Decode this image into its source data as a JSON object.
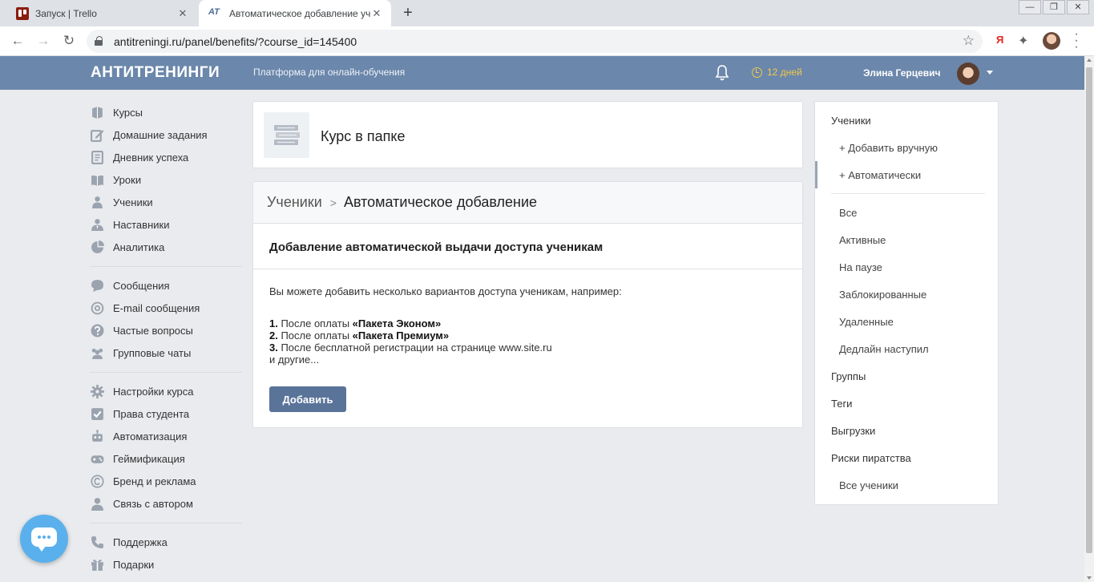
{
  "browser": {
    "tabs": [
      {
        "title": "Запуск | Trello",
        "close": "✕"
      },
      {
        "title": "Автоматическое добавление уч",
        "close": "✕",
        "favicon_text": "AT"
      }
    ],
    "new_tab": "+",
    "url": "antitreningi.ru/panel/benefits/?course_id=145400",
    "window_buttons": [
      "—",
      "❐",
      "✕"
    ],
    "ext_ya": "Я"
  },
  "header": {
    "logo": "АНТИТРЕНИНГИ",
    "tagline": "Платформа для онлайн-обучения",
    "trial": "12 дней",
    "username": "Элина Герцевич",
    "accent_color": "#6b87ab",
    "trial_color": "#f3c84a"
  },
  "nav": {
    "group1": [
      {
        "label": "Курсы",
        "icon": "book-icon"
      },
      {
        "label": "Домашние задания",
        "icon": "edit-icon"
      },
      {
        "label": "Дневник успеха",
        "icon": "diary-icon"
      },
      {
        "label": "Уроки",
        "icon": "lessons-icon"
      },
      {
        "label": "Ученики",
        "icon": "students-icon"
      },
      {
        "label": "Наставники",
        "icon": "mentors-icon"
      },
      {
        "label": "Аналитика",
        "icon": "pie-chart-icon"
      }
    ],
    "group2": [
      {
        "label": "Сообщения",
        "icon": "messages-icon"
      },
      {
        "label": "E-mail сообщения",
        "icon": "at-icon"
      },
      {
        "label": "Частые вопросы",
        "icon": "question-icon"
      },
      {
        "label": "Групповые чаты",
        "icon": "group-chat-icon"
      }
    ],
    "group3": [
      {
        "label": "Настройки курса",
        "icon": "gear-icon"
      },
      {
        "label": "Права студента",
        "icon": "checkbox-icon"
      },
      {
        "label": "Автоматизация",
        "icon": "robot-icon"
      },
      {
        "label": "Геймификация",
        "icon": "gamepad-icon"
      },
      {
        "label": "Бренд и реклама",
        "icon": "copyright-icon"
      },
      {
        "label": "Связь с автором",
        "icon": "user-icon"
      }
    ],
    "group4": [
      {
        "label": "Поддержка",
        "icon": "phone-icon"
      },
      {
        "label": "Подарки",
        "icon": "gift-icon"
      }
    ]
  },
  "course": {
    "title": "Курс в папке"
  },
  "main": {
    "breadcrumb_parent": "Ученики",
    "breadcrumb_sep": ">",
    "breadcrumb_current": "Автоматическое добавление",
    "section_title": "Добавление автоматической выдачи доступа ученикам",
    "intro": "Вы можете добавить несколько вариантов доступа ученикам, например:",
    "examples": [
      {
        "num": "1.",
        "text": " После оплаты ",
        "bold": "«Пакета Эконом»"
      },
      {
        "num": "2.",
        "text": " После оплаты ",
        "bold": "«Пакета Премиум»"
      },
      {
        "num": "3.",
        "text": " После бесплатной регистрации на странице www.site.ru",
        "bold": ""
      }
    ],
    "examples_tail": "и другие...",
    "add_button": "Добавить",
    "button_color": "#5a7399"
  },
  "right_panel": {
    "students": "Ученики",
    "add_manual": "+ Добавить вручную",
    "add_auto": "+ Автоматически",
    "filters": [
      "Все",
      "Активные",
      "На паузе",
      "Заблокированные",
      "Удаленные",
      "Дедлайн наступил"
    ],
    "groups": "Группы",
    "tags": "Теги",
    "exports": "Выгрузки",
    "piracy": "Риски пиратства",
    "all_students": "Все ученики"
  }
}
